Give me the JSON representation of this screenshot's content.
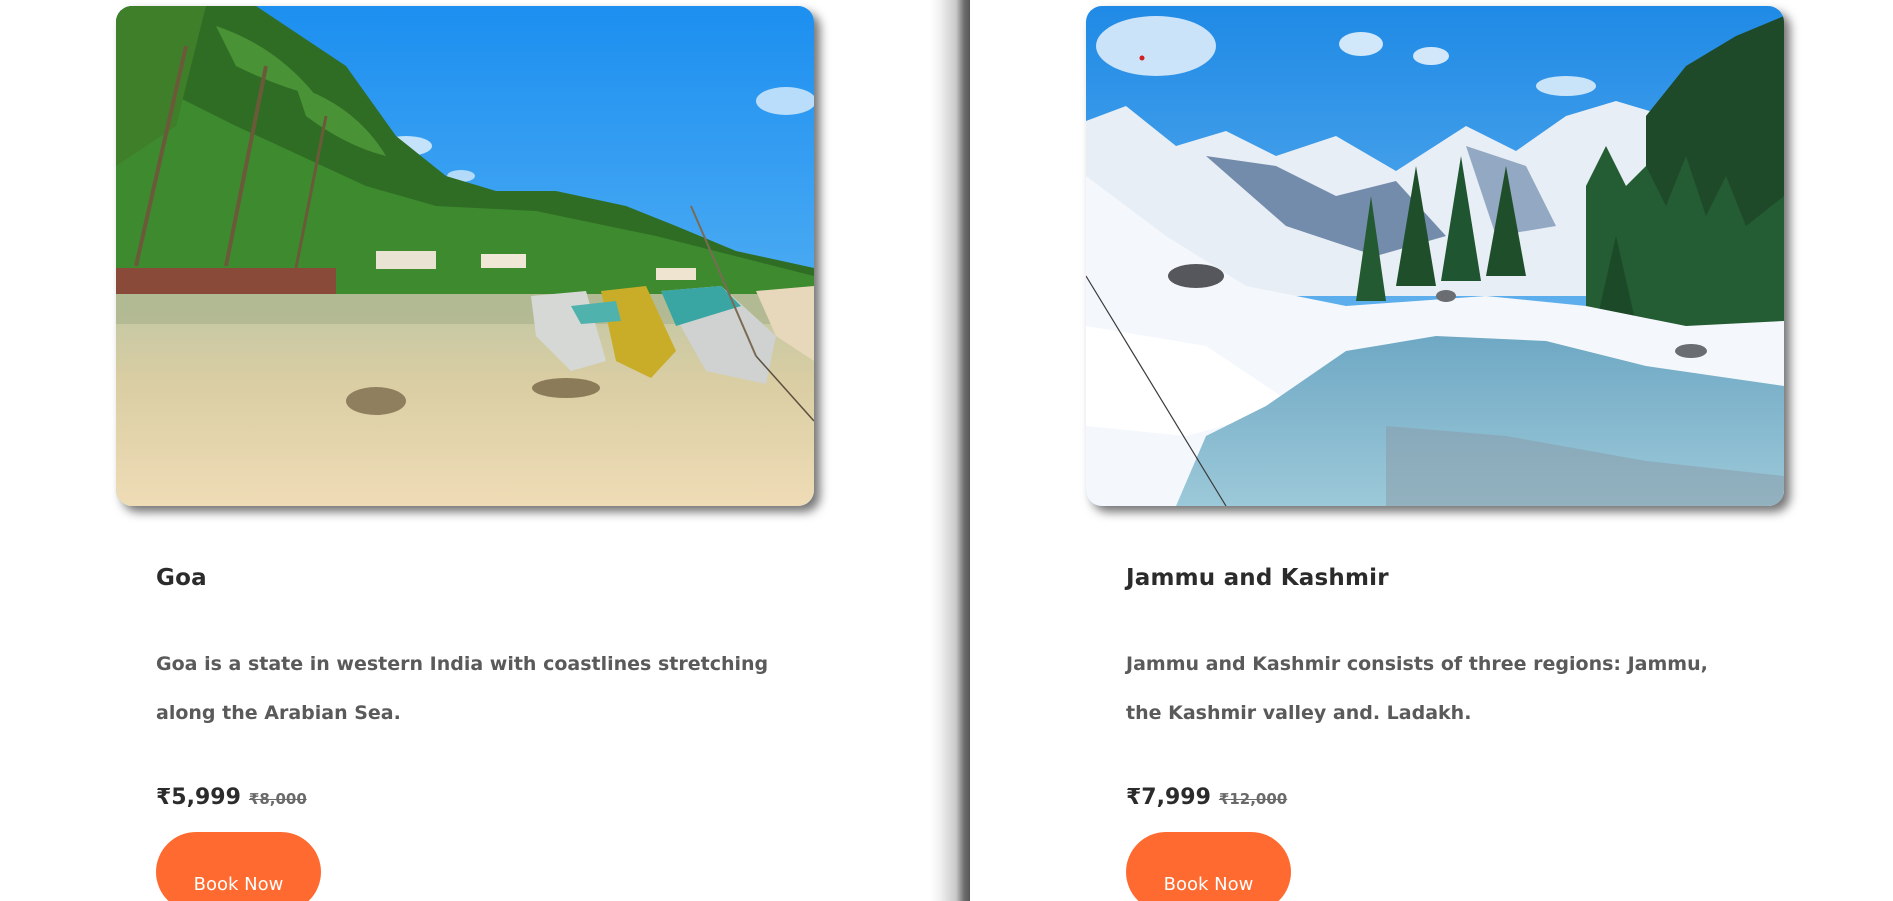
{
  "destinations": [
    {
      "name": "Goa",
      "description": "Goa is a state in western India with coastlines stretching along the Arabian Sea.",
      "price": "₹5,999",
      "old_price": "₹8,000",
      "button_label": "Book Now"
    },
    {
      "name": "Jammu and Kashmir",
      "description": "Jammu and Kashmir consists of three regions: Jammu, the Kashmir valley and. Ladakh.",
      "price": "₹7,999",
      "old_price": "₹12,000",
      "button_label": "Book Now"
    }
  ],
  "colors": {
    "accent": "#fe6a30",
    "title": "#2b2b2b",
    "description": "#5a5a5a"
  }
}
